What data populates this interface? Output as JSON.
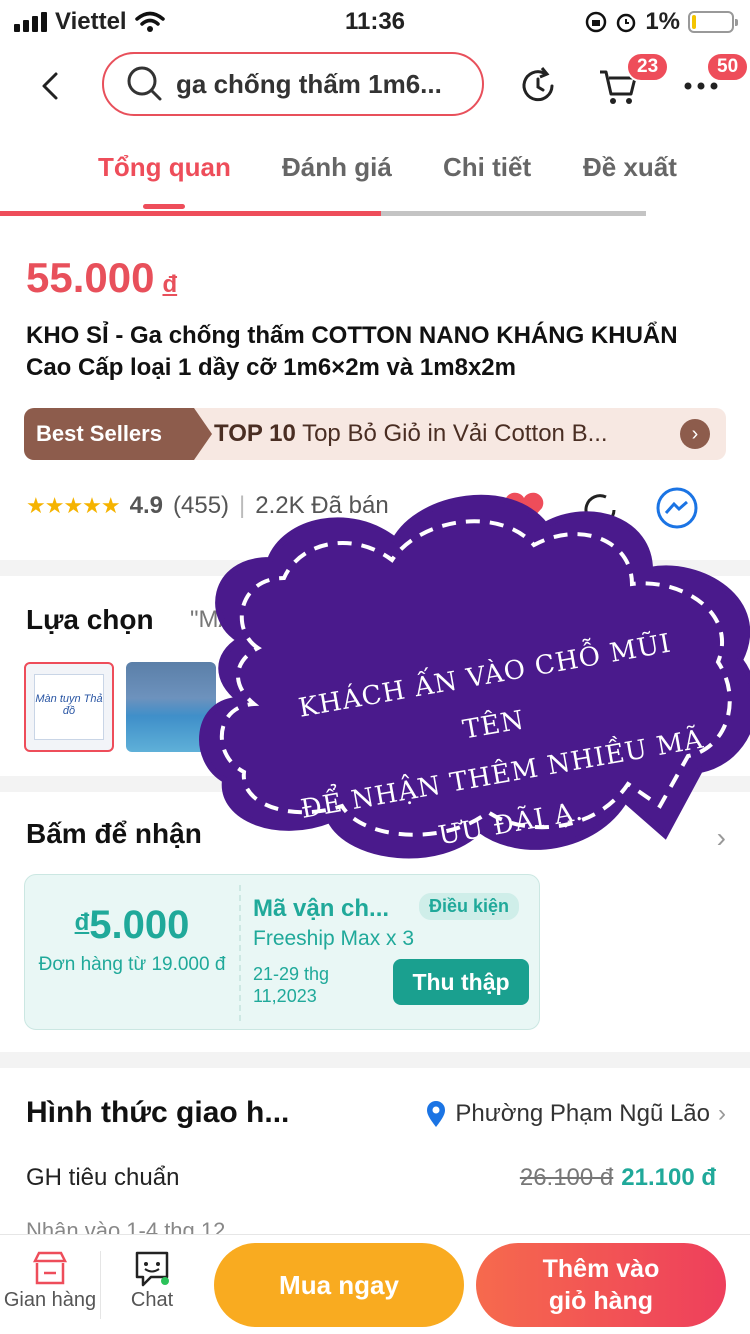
{
  "status_bar": {
    "carrier": "Viettel",
    "time": "11:36",
    "battery": "1%"
  },
  "header": {
    "search_text": "ga chống thấm 1m6...",
    "cart_badge": "23",
    "more_badge": "50",
    "icons": [
      "back-icon",
      "search-icon",
      "refresh-icon",
      "cart-icon",
      "more-icon"
    ]
  },
  "tabs": [
    "Tổng quan",
    "Đánh giá",
    "Chi tiết",
    "Đề xuất"
  ],
  "scroll_progress": 0.59,
  "product": {
    "price": "55.000",
    "currency": "đ",
    "title": "KHO SỈ - Ga chống thấm COTTON NANO KHÁNG KHUẨN Cao Cấp loại 1 dầy cỡ 1m6×2m và 1m8x2m",
    "best_seller": {
      "tag": "Best Sellers",
      "rank": "TOP 10",
      "text": "Top Bỏ Giỏ in Vải Cotton B..."
    },
    "rating": {
      "stars": 4.9,
      "value": "4.9",
      "count": "(455)",
      "sold": "2.2K Đã bán"
    }
  },
  "options": {
    "title": "Lựa chọn",
    "value": "\"MÀN T",
    "thumb1_label": "Màn tuyn Thả đồ"
  },
  "voucher_section": {
    "title": "Bấm để nhận",
    "amount_symbol": "đ",
    "amount": "5.000",
    "condition": "Đơn hàng từ 19.000 đ",
    "name": "Mã vận ch...",
    "pill": "Điều kiện",
    "sub": "Freeship Max x 3",
    "date_line1": "21-29 thg",
    "date_line2": "11,2023",
    "button": "Thu thập"
  },
  "shipping": {
    "title": "Hình thức giao h...",
    "location": "Phường Phạm Ngũ Lão",
    "method": "GH tiêu chuẩn",
    "old_price": "26.100 đ",
    "new_price": "21.100 đ",
    "next_line": "Nhận vào 1-4 thg 12"
  },
  "overlay": {
    "line1": "KHÁCH ẤN VÀO CHỖ MŨI TÊN",
    "line2": "ĐỂ NHẬN THÊM NHIỀU MÃ ƯU ĐÃI Ạ.",
    "color": "#4a1a8c"
  },
  "bottom_bar": {
    "shop_label": "Gian hàng",
    "chat_label": "Chat",
    "buy_now": "Mua ngay",
    "add_cart_line1": "Thêm vào",
    "add_cart_line2": "giỏ hàng"
  },
  "colors": {
    "accent": "#ee4d5a",
    "teal": "#20a99a",
    "buy": "#f9ab20"
  }
}
